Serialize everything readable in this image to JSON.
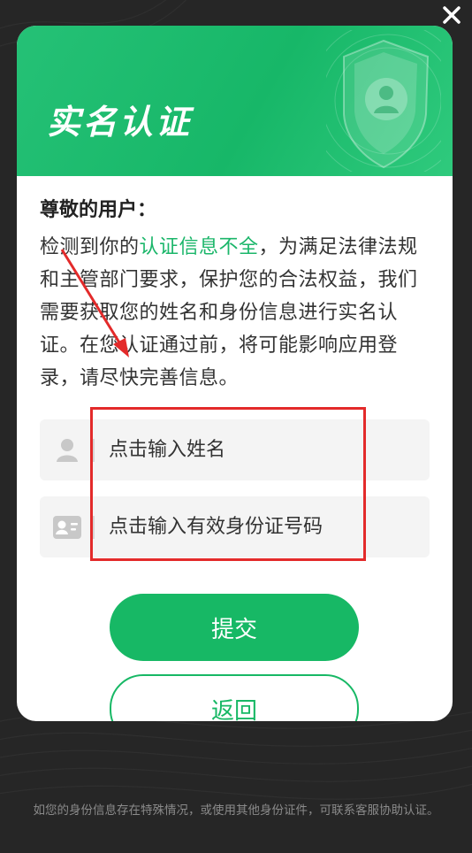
{
  "dialog": {
    "title": "实名认证",
    "greeting": "尊敬的用户：",
    "body_prefix": "检测到你的",
    "body_highlight": "认证信息不全",
    "body_suffix": "，为满足法律法规和主管部门要求，保护您的合法权益，我们需要获取您的姓名和身份信息进行实名认证。在您认证通过前，将可能影响应用登录，请尽快完善信息。",
    "name_field": {
      "placeholder": "点击输入姓名",
      "value": ""
    },
    "id_field": {
      "placeholder": "点击输入有效身份证号码",
      "value": ""
    },
    "submit_label": "提交",
    "back_label": "返回"
  },
  "footer": {
    "note": "如您的身份信息存在特殊情况，或使用其他身份证件，可联系客服协助认证。"
  },
  "colors": {
    "accent": "#17b865",
    "highlight_text": "#1bb66a",
    "background": "#262626",
    "annotation": "#e32a2a"
  },
  "icons": {
    "close": "close-icon",
    "person": "person-icon",
    "id_card": "id-card-icon",
    "shield": "shield-user-icon"
  }
}
